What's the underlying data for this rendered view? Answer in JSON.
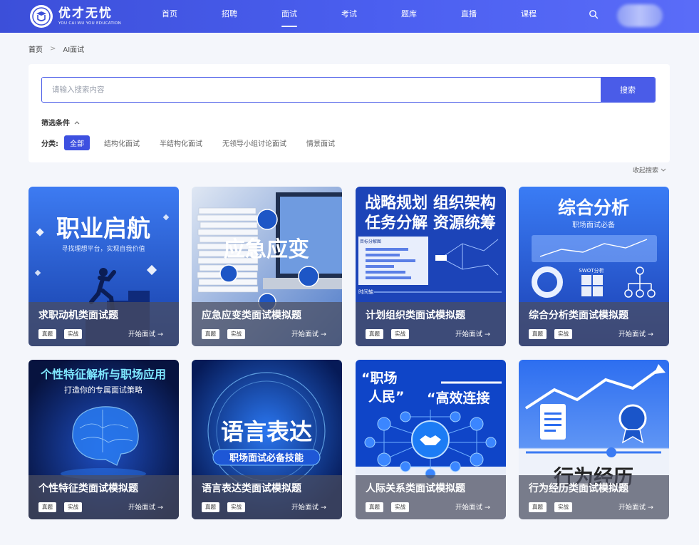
{
  "header": {
    "logo_cn": "优才无忧",
    "logo_en": "YOU CAI WU YOU EDUCATION",
    "nav": [
      "首页",
      "招聘",
      "面试",
      "考试",
      "题库",
      "直播",
      "课程"
    ],
    "active_nav_index": 2
  },
  "breadcrumb": {
    "home": "首页",
    "current": "AI面试"
  },
  "search": {
    "placeholder": "请输入搜索内容",
    "button": "搜索"
  },
  "filter": {
    "title": "筛选条件",
    "category_label": "分类:",
    "categories": [
      "全部",
      "结构化面试",
      "半结构化面试",
      "无领导小组讨论面试",
      "情景面试"
    ],
    "active_index": 0,
    "collapse": "收起搜索"
  },
  "colors": {
    "brand": "#4a5ce8",
    "header_start": "#3c4fd9"
  },
  "cards": [
    {
      "title": "求职动机类面试题",
      "tag1": "真题",
      "tag2": "实战",
      "start": "开始面试 →",
      "art_main": "职业启航",
      "art_sub": "寻找理想平台，实现自我价值"
    },
    {
      "title": "应急应变类面试模拟题",
      "tag1": "真题",
      "tag2": "实战",
      "start": "开始面试 →",
      "art_main": "应急应变"
    },
    {
      "title": "计划组织类面试模拟题",
      "tag1": "真题",
      "tag2": "实战",
      "start": "开始面试 →",
      "art_line1": "战略规划 组织架构",
      "art_line2": "任务分解 资源统筹",
      "art_label1": "目标分解图",
      "art_label2": "时间轴"
    },
    {
      "title": "综合分析类面试模拟题",
      "tag1": "真题",
      "tag2": "实战",
      "start": "开始面试 →",
      "art_main": "综合分析",
      "art_sub": "职场面试必备",
      "art_label1": "SWOT分析"
    },
    {
      "title": "个性特征类面试模拟题",
      "tag1": "真题",
      "tag2": "实战",
      "start": "开始面试 →",
      "art_main": "个性特征解析与职场应用",
      "art_sub": "打造你的专属面试策略"
    },
    {
      "title": "语言表达类面试模拟题",
      "tag1": "真题",
      "tag2": "实战",
      "start": "开始面试 →",
      "art_main": "语言表达",
      "art_sub": "职场面试必备技能"
    },
    {
      "title": "人际关系类面试模拟题",
      "tag1": "真题",
      "tag2": "实战",
      "start": "开始面试 →",
      "art_line1": "“职场",
      "art_line2": "人民”",
      "art_line3": "“高效连接"
    },
    {
      "title": "行为经历类面试模拟题",
      "tag1": "真题",
      "tag2": "实战",
      "start": "开始面试 →",
      "art_main": "行为经历"
    }
  ]
}
